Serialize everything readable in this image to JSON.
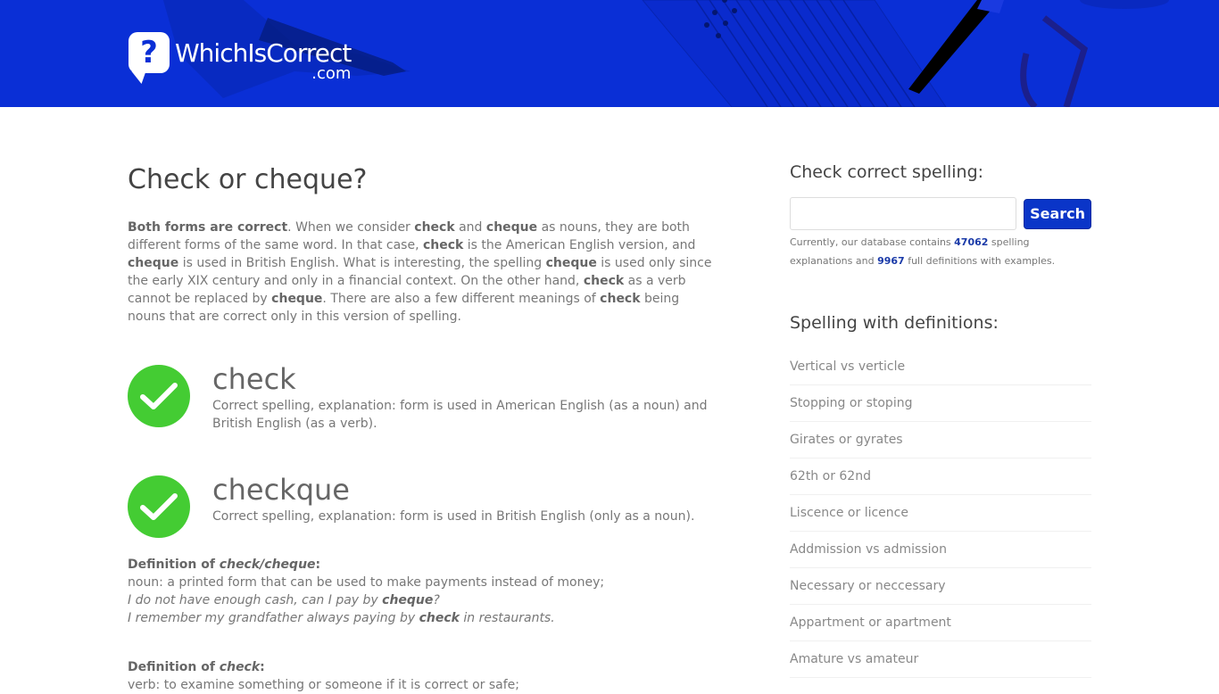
{
  "header": {
    "logo_name": "WhichIsCorrect",
    "logo_tld": ".com",
    "logo_symbol": "?"
  },
  "main": {
    "title": "Check or cheque?",
    "intro": [
      {
        "t": "Both forms are correct",
        "b": true
      },
      {
        "t": ". When we consider "
      },
      {
        "t": "check",
        "b": true
      },
      {
        "t": " and "
      },
      {
        "t": "cheque",
        "b": true
      },
      {
        "t": " as nouns, they are both different forms of the same word. In that case, "
      },
      {
        "t": "check",
        "b": true
      },
      {
        "t": " is the American English version, and "
      },
      {
        "t": "cheque",
        "b": true
      },
      {
        "t": " is used in British English. What is interesting, the spelling "
      },
      {
        "t": "cheque",
        "b": true
      },
      {
        "t": " is used only since the early XIX century and only in a financial context. On the other hand, "
      },
      {
        "t": "check",
        "b": true
      },
      {
        "t": " as a verb cannot be replaced by "
      },
      {
        "t": "cheque",
        "b": true
      },
      {
        "t": ". There are also a few different meanings of "
      },
      {
        "t": "check",
        "b": true
      },
      {
        "t": " being nouns that are correct only in this version of spelling."
      }
    ],
    "spellings": [
      {
        "word": "check",
        "explanation": "Correct spelling, explanation: form is used in American English (as a noun) and British English (as a verb).",
        "status": "correct"
      },
      {
        "word": "checkque",
        "explanation": "Correct spelling, explanation: form is used in British English (only as a noun).",
        "status": "correct"
      }
    ],
    "definitions": [
      {
        "title_prefix": "Definition of ",
        "title_term": "check/cheque",
        "title_suffix": ":",
        "meaning": "noun: a printed form that can be used to make payments instead of money;",
        "examples": [
          {
            "pre": "I do not have enough cash, can I pay by ",
            "bold": "cheque",
            "post": "?"
          },
          {
            "pre": "I remember my grandfather always paying by ",
            "bold": "check",
            "post": " in restaurants."
          }
        ]
      },
      {
        "title_prefix": "Definition of ",
        "title_term": "check",
        "title_suffix": ":",
        "meaning": "verb: to examine something or someone if it is correct or safe;",
        "examples": []
      }
    ]
  },
  "sidebar": {
    "search_title": "Check correct spelling:",
    "search_value": "",
    "search_placeholder": "",
    "search_button": "Search",
    "db_pre": "Currently, our database contains ",
    "db_spelling_count": "47062",
    "db_mid": " spelling explanations and ",
    "db_def_count": "9967",
    "db_post": " full definitions with examples.",
    "defs_title": "Spelling with definitions:",
    "links": [
      "Vertical vs verticle",
      "Stopping or stoping",
      "Girates or gyrates",
      "62th or 62nd",
      "Liscence or licence",
      "Addmission vs admission",
      "Necessary or neccessary",
      "Appartment or apartment",
      "Amature vs amateur"
    ]
  },
  "colors": {
    "header_bg": "#0a2fd6",
    "check_green": "#44cc33",
    "button_blue": "#0a35c8",
    "count_blue": "#1a3aa8"
  }
}
